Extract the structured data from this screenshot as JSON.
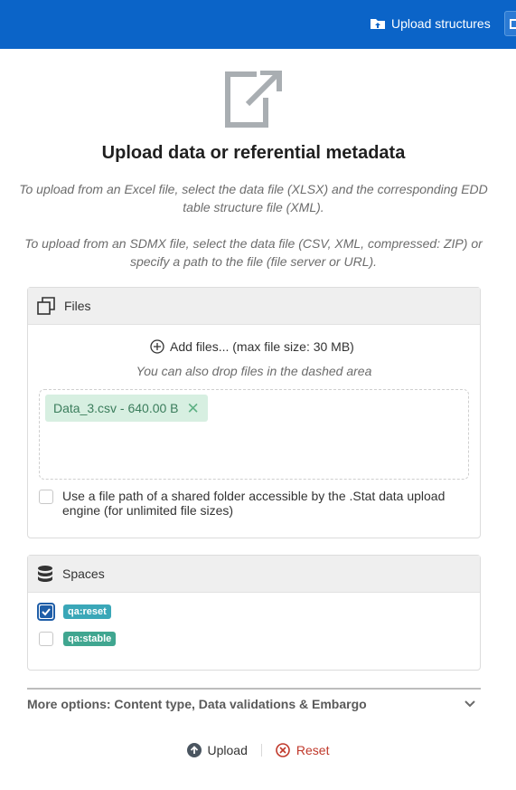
{
  "topbar": {
    "upload_structures_label": "Upload structures",
    "color": "#0b64c8"
  },
  "page": {
    "title": "Upload data or referential metadata",
    "description_excel": "To upload from an Excel file, select the data file (XLSX) and the corresponding EDD table structure file (XML).",
    "description_sdmx": "To upload from an SDMX file, select the data file (CSV, XML, compressed: ZIP) or specify a path to the file (file server or URL).",
    "hero_icon": "external-link-icon"
  },
  "files_panel": {
    "title": "Files",
    "icon": "copy-icon",
    "add_files_label": "Add files... (max file size: 30 MB)",
    "drop_hint": "You can also drop files in the dashed area",
    "files": [
      {
        "label": "Data_3.csv - 640.00 B"
      }
    ],
    "shared_path_label": "Use a file path of a shared folder accessible by the .Stat data upload engine (for unlimited file sizes)",
    "shared_path_checked": false
  },
  "spaces_panel": {
    "title": "Spaces",
    "icon": "database-icon",
    "spaces": [
      {
        "label": "qa:reset",
        "checked": true,
        "color": "#3aa7b8"
      },
      {
        "label": "qa:stable",
        "checked": false,
        "color": "#40a690"
      }
    ]
  },
  "more_options": {
    "label": "More options: Content type, Data validations & Embargo"
  },
  "actions": {
    "upload_label": "Upload",
    "reset_label": "Reset",
    "reset_color": "#c0392b"
  }
}
